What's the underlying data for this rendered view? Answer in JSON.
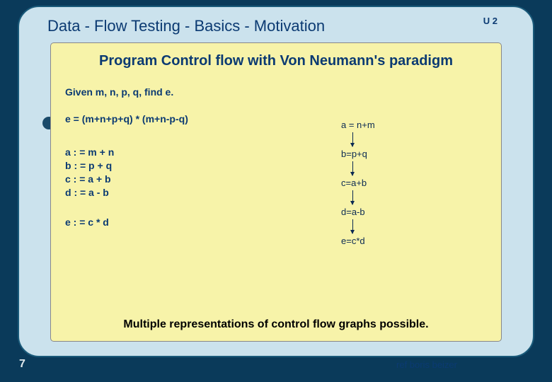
{
  "header": {
    "title": "Data - Flow Testing   -  Basics  - Motivation",
    "badge": "U 2"
  },
  "content": {
    "title": "Program Control flow with Von Neumann's paradigm",
    "given": "Given m, n, p, q, find e.",
    "main_equation": "e = (m+n+p+q) * (m+n-p-q)",
    "assignments": [
      "a : = m + n",
      "b : = p + q",
      "c : = a + b",
      "d : = a - b"
    ],
    "assignment_e": "e : = c * d",
    "flow_steps": [
      "a = n+m",
      "b=p+q",
      "c=a+b",
      "d=a-b",
      "e=c*d"
    ],
    "footer": "Multiple representations of control flow graphs possible."
  },
  "ref_text": "ref boris beizer",
  "page_number": "7"
}
